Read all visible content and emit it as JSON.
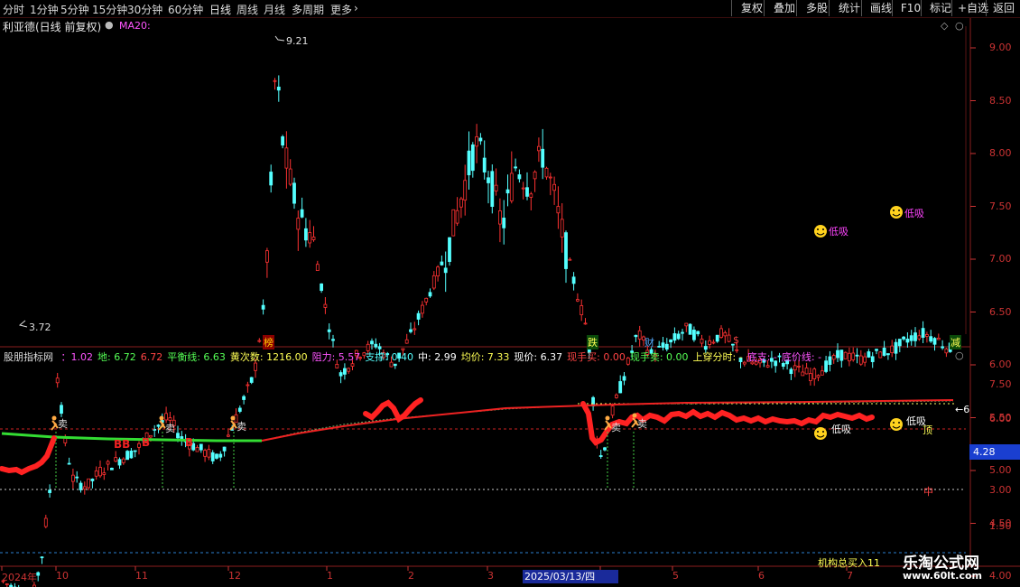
{
  "toolbar": {
    "timeframes": [
      "分时",
      "1分钟",
      "5分钟",
      "15分钟",
      "30分钟",
      "60分钟",
      "日线",
      "周线",
      "月线",
      "多周期",
      "更多"
    ],
    "active_timeframe": "日线",
    "buttons": [
      "复权",
      "叠加",
      "多股",
      "统计",
      "画线",
      "F10",
      "标记",
      "+自选",
      "返回"
    ]
  },
  "main": {
    "title": "利亚德(日线 前复权)",
    "ma_label": "MA20:",
    "high_label": "9.21",
    "low_label": "3.72",
    "y_ticks": [
      "9.00",
      "8.50",
      "8.00",
      "7.50",
      "7.00",
      "6.50",
      "6.00",
      "5.50",
      "5.00",
      "4.50",
      "4.00"
    ],
    "events": [
      "榜",
      "跌",
      "财",
      "$",
      "减"
    ],
    "signals": [
      "低吸",
      "低吸"
    ]
  },
  "indicator": {
    "title": "股朋指标网",
    "fields": [
      {
        "label": "：1.02",
        "color": "#ff55ff"
      },
      {
        "label": "地: 6.72",
        "color": "#55ff55"
      },
      {
        "label": "6.72",
        "color": "#ff4444"
      },
      {
        "label": "平衡线: 6.63",
        "color": "#55ff55"
      },
      {
        "label": "黄次数: 1216.00",
        "color": "#ffff55"
      },
      {
        "label": "阻力: 5.57",
        "color": "#ff55ff"
      },
      {
        "label": "支撑: 0.40",
        "color": "#55ffff"
      },
      {
        "label": "中: 2.99",
        "color": "#ffffff"
      },
      {
        "label": "均价: 7.33",
        "color": "#ffff55"
      },
      {
        "label": "现价: 6.37",
        "color": "#ffffff"
      },
      {
        "label": "现手买: 0.00",
        "color": "#ff4444"
      },
      {
        "label": "现手卖: 0.00",
        "color": "#55ff55"
      },
      {
        "label": "上穿分时: -",
        "color": "#ffff55"
      },
      {
        "label": "底支: -",
        "color": "#ff55ff"
      },
      {
        "label": "底价线: -",
        "color": "#ff55ff"
      }
    ],
    "y_ticks": [
      "7.50",
      "6.00",
      "4.28",
      "3.00",
      "1.50"
    ],
    "current_value": "4.28",
    "line_marker": "←6",
    "mid_marker": "中",
    "sell_label": "卖",
    "buy_label": "B",
    "buy_double": "BB",
    "signal_label": "低吸",
    "top_label": "顶",
    "institution": "机构总买入11"
  },
  "x_axis": {
    "labels": [
      "2024年",
      "10",
      "11",
      "12",
      "1",
      "2",
      "3",
      "4",
      "5",
      "6",
      "7"
    ],
    "highlight": "2025/03/13/四"
  },
  "watermark": {
    "name": "乐淘公式网",
    "url": "www.60lt.com"
  },
  "colors": {
    "up": "#ff3232",
    "down": "#54ffff",
    "grid": "#7a1f1f",
    "axis_text": "#cc3333"
  }
}
